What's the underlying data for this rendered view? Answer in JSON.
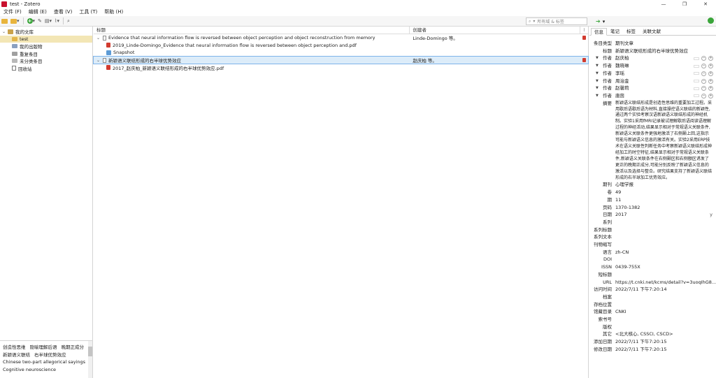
{
  "window": {
    "title": "test - Zotero"
  },
  "menu": [
    "文件 (F)",
    "编辑 (E)",
    "查看 (V)",
    "工具 (T)",
    "帮助 (H)"
  ],
  "toolbar": {
    "search_placeholder": "所有域 & 标签"
  },
  "collections": [
    {
      "label": "我的文库",
      "level": 0,
      "icon": "library",
      "selected": false
    },
    {
      "label": "test",
      "level": 1,
      "icon": "folder",
      "selected": true
    },
    {
      "label": "我的出版物",
      "level": 1,
      "icon": "folder",
      "selected": false
    },
    {
      "label": "重复条目",
      "level": 1,
      "icon": "folder",
      "selected": false
    },
    {
      "label": "未分类条目",
      "level": 1,
      "icon": "folder",
      "selected": false
    },
    {
      "label": "回收站",
      "level": 1,
      "icon": "trash",
      "selected": false
    }
  ],
  "tags": {
    "row1": [
      "创造性思维",
      "隐喻理解后语",
      "晚期正成分"
    ],
    "row2": [
      "新颖语义联结",
      "右半球优势效应"
    ],
    "row3": "Chinese two-part allegorical sayings",
    "row4": "Cognitive neuroscience"
  },
  "items_pane": {
    "headers": {
      "title": "标题",
      "creator": "创建者"
    },
    "rows": [
      {
        "type": "parent",
        "title": "Evidence that neural information flow is reversed between object perception and object reconstruction from memory",
        "creator": "Linde-Domingo 等。",
        "selected": false
      },
      {
        "type": "pdf",
        "title": "2019_Linde-Domingo_Evidence that neural information flow is reversed between object perception and.pdf",
        "creator": "",
        "selected": false
      },
      {
        "type": "snapshot",
        "title": "Snapshot",
        "creator": "",
        "selected": false
      },
      {
        "type": "parent",
        "title": "新颖语义联结形成的右半球优势效应",
        "creator": "赵庆柏 等。",
        "selected": true
      },
      {
        "type": "pdf",
        "title": "2017_赵庆柏_新颖语义联结形成的右半球优势效应.pdf",
        "creator": "",
        "selected": false
      }
    ]
  },
  "item_pane": {
    "tabs": [
      "信息",
      "笔记",
      "标签",
      "关联文献"
    ],
    "item_type": {
      "label": "条目类型",
      "value": "期刊文章"
    },
    "title": {
      "label": "标题",
      "value": "新颖语义联结形成的右半球优势效应"
    },
    "creators": [
      {
        "label": "作者",
        "name": "赵庆柏"
      },
      {
        "label": "作者",
        "name": "魏晓琳"
      },
      {
        "label": "作者",
        "name": "李瑶"
      },
      {
        "label": "作者",
        "name": "周治金"
      },
      {
        "label": "作者",
        "name": "赵馨莉"
      },
      {
        "label": "作者",
        "name": "唐茵"
      }
    ],
    "abstract": {
      "label": "摘要",
      "value": "新颖语义联结形成是创造性思维的重要加工过程。采用歇后语歇后语为材料,直接操控语义联结的新颖性,通过两个实验考察汉语新颖语义联结形成的神经机制。实验1采用fMRI记录被试理解歇后语阅读语理解过程的神经活动,结果显示相对于常规语义关联条件,新颖语义关联条件更强地激活了右侧颞上回,这指示可能与新颖语义信息的激活有关。实验2采用ERP技术在语义关联性判断任务中考察新颖语义联结形成神经加工的时空特征,结果显示相对于常规语义关联条件,新颖语义关联条件在右侧颞区和右侧额区诱发了更正的晚期正成分,可能分别反映了新颖语义信息的激活以及选择与整合。研究结果支持了新颖语义联结形成的右半球加工优势效应。"
    },
    "publication": {
      "label": "期刊",
      "value": "心理学报"
    },
    "volume": {
      "label": "卷",
      "value": "49"
    },
    "issue": {
      "label": "期",
      "value": "11"
    },
    "pages": {
      "label": "页码",
      "value": "1370-1382"
    },
    "date": {
      "label": "日期",
      "value": "2017",
      "suffix": "y"
    },
    "series": {
      "label": "系列",
      "value": ""
    },
    "series_title": {
      "label": "系列标题",
      "value": ""
    },
    "series_text": {
      "label": "系列文本",
      "value": ""
    },
    "journal_abbr": {
      "label": "刊物缩写",
      "value": ""
    },
    "language": {
      "label": "语言",
      "value": "zh-CN"
    },
    "doi": {
      "label": "DOI",
      "value": ""
    },
    "issn": {
      "label": "ISSN",
      "value": "0439-755X"
    },
    "short_title": {
      "label": "短标题",
      "value": ""
    },
    "url": {
      "label": "URL",
      "value": "https://t.cnki.net/kcms/detail?v=3uoqIhG8..."
    },
    "accessed": {
      "label": "访问时间",
      "value": "2022/7/11 下午7:20:14"
    },
    "archive": {
      "label": "档案",
      "value": ""
    },
    "loc_in_archive": {
      "label": "存档位置",
      "value": ""
    },
    "library_catalog": {
      "label": "馆藏目录",
      "value": "CNKI"
    },
    "call_number": {
      "label": "索书号",
      "value": ""
    },
    "rights": {
      "label": "版权",
      "value": ""
    },
    "extra": {
      "label": "其它",
      "value": "<北大核心, CSSCI, CSCD>"
    },
    "date_added": {
      "label": "添加日期",
      "value": "2022/7/11 下午7:20:15"
    },
    "date_modified": {
      "label": "修改日期",
      "value": "2022/7/11 下午7:20:15"
    }
  }
}
